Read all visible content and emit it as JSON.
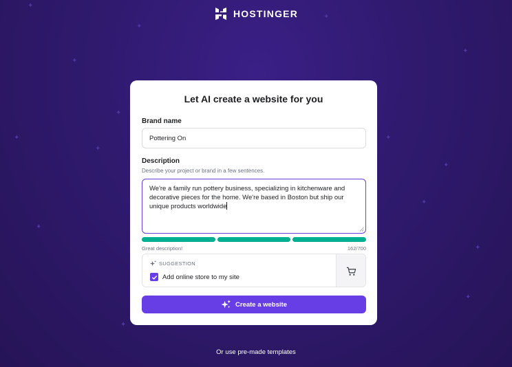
{
  "brand": {
    "logo_text": "HOSTINGER"
  },
  "card": {
    "title": "Let AI create a website for you",
    "brand_name_label": "Brand name",
    "brand_name_value": "Pottering On",
    "description_label": "Description",
    "description_helper": "Describe your project or brand in a few sentences.",
    "description_value": "We're a family run pottery business, specializing in kitchenware and decorative pieces for the home. We're based in Boston but ship our unique products worldwide",
    "strength_hint": "Great description!",
    "char_counter": "162/700",
    "suggestion": {
      "heading": "SUGGESTION",
      "option_label": "Add online store to my site",
      "checked": true
    },
    "create_button_label": "Create a website"
  },
  "footer": {
    "templates_link": "Or use pre-made templates"
  },
  "colors": {
    "accent": "#673de6",
    "success": "#00b090",
    "background": "#2f1a6e"
  }
}
